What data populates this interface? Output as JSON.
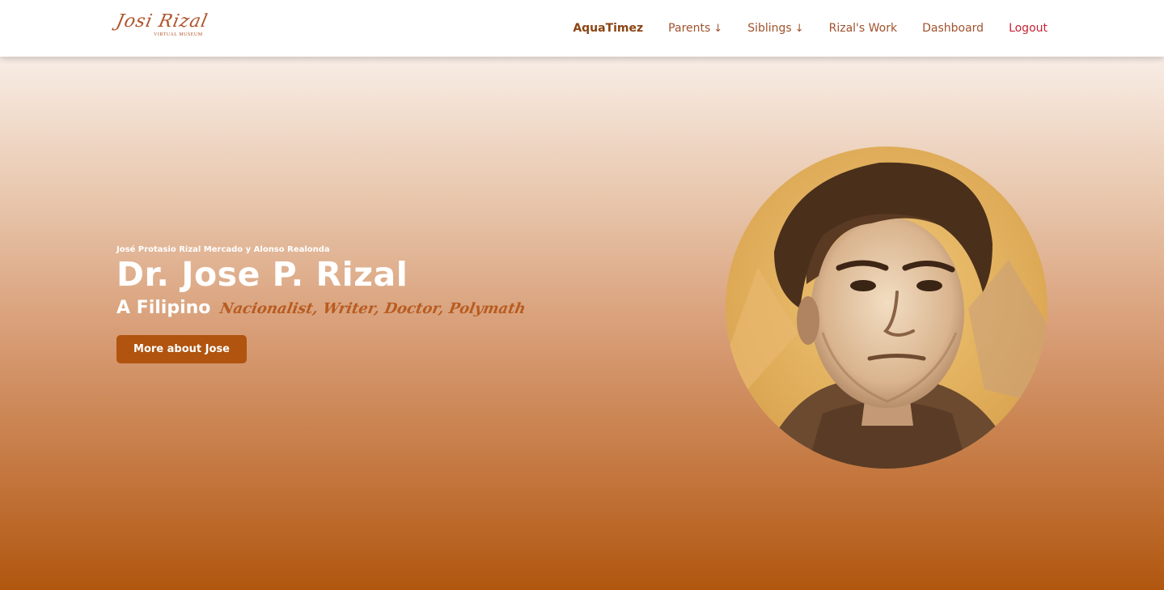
{
  "brand": {
    "logo_script": "Josi Rizal",
    "logo_subtitle": "VIRTUAL MUSEUM"
  },
  "nav": {
    "items": [
      {
        "label": "AquaTimez"
      },
      {
        "label": "Parents"
      },
      {
        "label": "Siblings"
      },
      {
        "label": "Rizal's Work"
      },
      {
        "label": "Dashboard"
      },
      {
        "label": "Logout"
      }
    ],
    "dropdown_icon": "arrow-down-icon"
  },
  "hero": {
    "subtitle": "José Protasio Rizal Mercado y Alonso Realonda",
    "title": "Dr. Jose P. Rizal",
    "tagline_lead": "A Filipino",
    "tagline_script": "Nacionalist, Writer, Doctor, Polymath",
    "cta_label": "More about Jose"
  },
  "colors": {
    "accent": "#b0540f",
    "nav_text": "#a0522d",
    "logout": "#c82333",
    "gradient_top": "#f8ede6",
    "gradient_bottom": "#b0560f"
  }
}
